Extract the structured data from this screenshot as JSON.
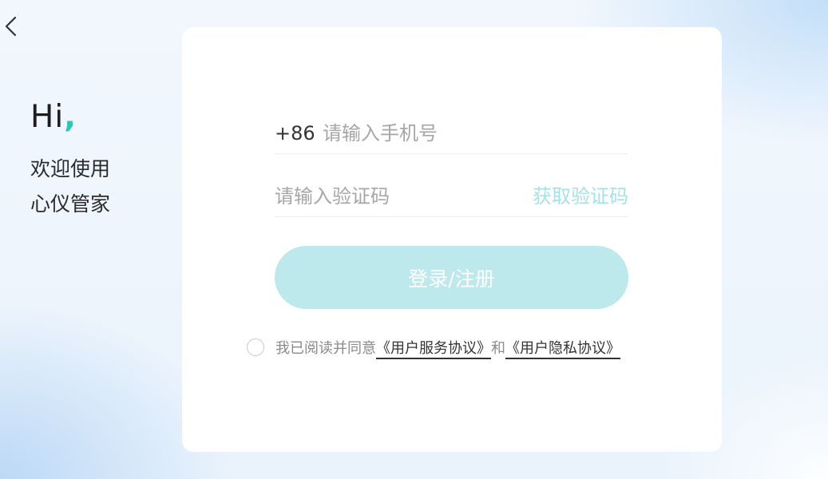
{
  "greeting": {
    "hi": "Hi",
    "comma": ",",
    "welcome_line1": "欢迎使用",
    "welcome_line2": "心仪管家"
  },
  "login_form": {
    "phone_prefix": "+86",
    "phone_placeholder": "请输入手机号",
    "code_placeholder": "请输入验证码",
    "get_code_label": "获取验证码",
    "submit_label": "登录/注册"
  },
  "agreement": {
    "prefix_text": "我已阅读并同意",
    "service_link": "《用户服务协议》",
    "conjunction": "和",
    "privacy_link": "《用户隐私协议》"
  },
  "icons": {
    "back": "chevron-left-icon",
    "agree_checkbox": "radio-circle-icon"
  },
  "colors": {
    "accent_teal": "#2ec4b6",
    "button_bg": "#bde9ec",
    "get_code_text": "#a4e2e6"
  }
}
